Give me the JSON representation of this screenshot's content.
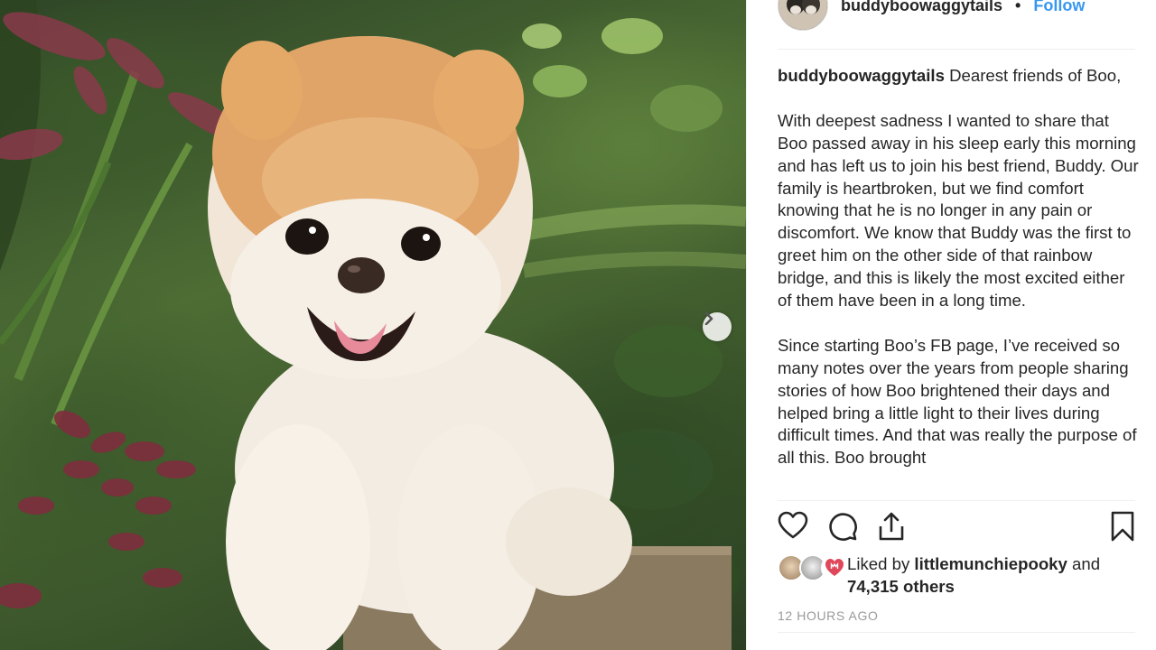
{
  "post": {
    "username": "buddyboowaggytails",
    "separator": "•",
    "follow_label": "Follow",
    "caption_user": "buddyboowaggytails",
    "caption_intro": " Dearest friends of Boo,",
    "caption_p2": "With deepest sadness I wanted to share that Boo passed away in his sleep early this morning and has left us to join his best friend, Buddy. Our family is heartbroken, but we find comfort knowing that he is no longer in any pain or discomfort. We know that Buddy was the first to greet him on the other side of that rainbow bridge, and this is likely the most excited either of them have been in a long time.",
    "caption_p3": "Since starting Boo’s FB page, I’ve received so many notes over the years from people sharing stories of how Boo brightened their days and helped bring a little light to their lives during difficult times. And that was really the purpose of all this. Boo brought"
  },
  "likes": {
    "prefix": "Liked by ",
    "user": "littlemunchiepooky",
    "mid": " and",
    "count_text": "74,315 others"
  },
  "timestamp": "12 HOURS AGO",
  "icons": [
    "heart-icon",
    "comment-icon",
    "share-icon",
    "bookmark-icon",
    "chevron-right-icon"
  ],
  "colors": {
    "follow": "#3897f0",
    "text": "#262626",
    "muted": "#999999"
  }
}
